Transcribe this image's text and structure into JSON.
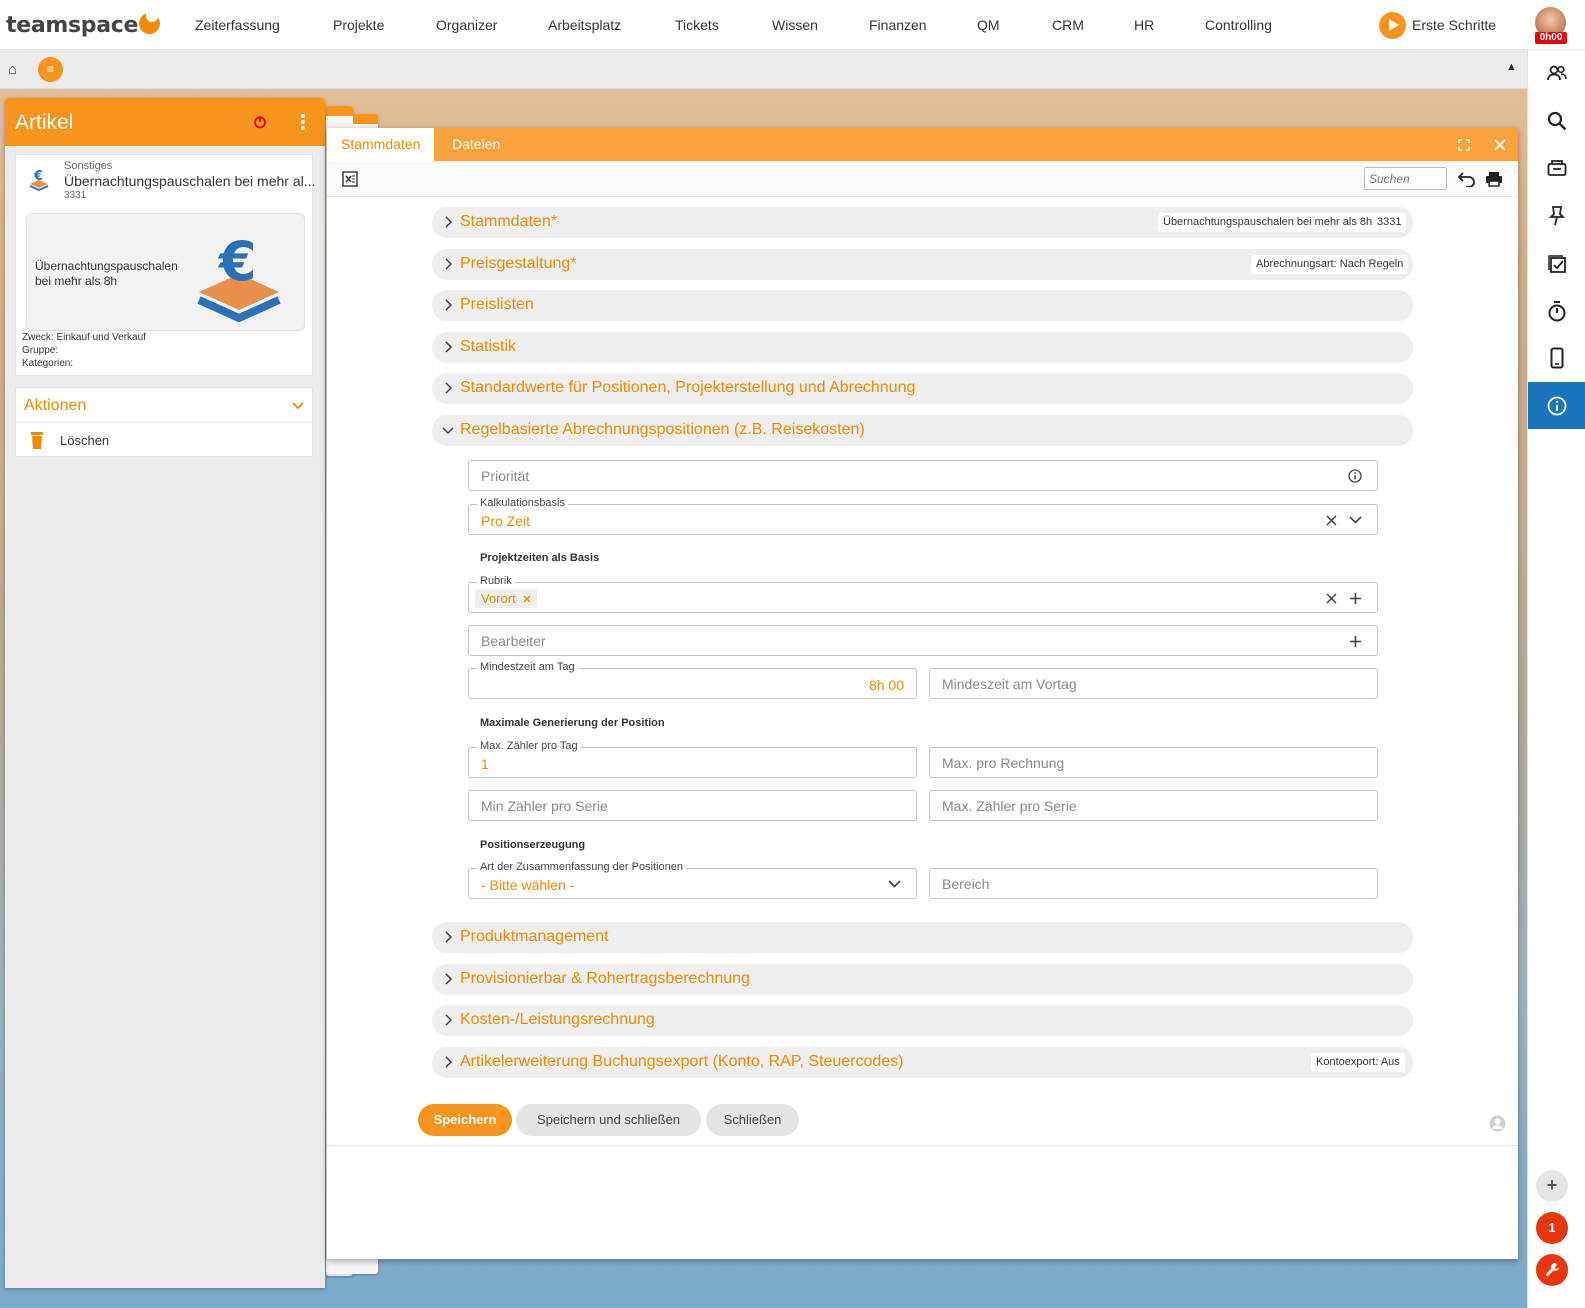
{
  "app": {
    "brand": "teamspace",
    "accent": "#f7941d",
    "accent_text": "#f08a00",
    "info_blue": "#1b75bc"
  },
  "topnav": {
    "items": [
      "Zeiterfassung",
      "Projekte",
      "Organizer",
      "Arbeitsplatz",
      "Tickets",
      "Wissen",
      "Finanzen",
      "QM",
      "CRM",
      "HR",
      "Controlling"
    ],
    "erste_schritte": "Erste Schritte",
    "timer": "0h00"
  },
  "subbar": {
    "home_icon": "house-icon",
    "menu_icon": "menu-icon",
    "collapse_icon": "triangle-up-icon"
  },
  "sidebar_right": {
    "icons": [
      "users-icon",
      "search-icon",
      "inbox-icon",
      "pin-icon",
      "checklist-icon",
      "stopwatch-icon",
      "phone-icon",
      "info-icon"
    ],
    "notification_count": "1"
  },
  "left_panel": {
    "title": "Artikel",
    "card": {
      "category": "Sonstiges",
      "name": "Übernachtungspauschalen bei mehr al...",
      "number": "3331",
      "preview_text_1": "Übernachtungspauschalen",
      "preview_text_2": "bei mehr als 8h",
      "zweck": "Zweck: Einkauf und Verkauf",
      "gruppe": "Gruppe:",
      "kategorien": "Kategorien:"
    },
    "actions": {
      "title": "Aktionen",
      "items": [
        {
          "label": "Löschen",
          "icon": "trash-icon"
        }
      ]
    }
  },
  "dialog": {
    "tabs": [
      {
        "label": "Stammdaten",
        "active": true
      },
      {
        "label": "Dateien",
        "active": false
      }
    ],
    "search_placeholder": "Suchen",
    "sections_top": [
      {
        "title": "Stammdaten*",
        "pills": [
          "Übernachtungspauschalen bei mehr als 8h",
          "3331"
        ]
      },
      {
        "title": "Preisgestaltung*",
        "pills": [
          "Abrechnungsart: Nach Regeln"
        ]
      },
      {
        "title": "Preislisten",
        "pills": []
      },
      {
        "title": "Statistik",
        "pills": []
      },
      {
        "title": "Standardwerte für Positionen, Projekterstellung und Abrechnung",
        "pills": []
      },
      {
        "title": "Regelbasierte Abrechnungspositionen (z.B. Reisekosten)",
        "pills": [],
        "expanded": true
      }
    ],
    "form": {
      "prioritaet_placeholder": "Priorität",
      "kalkulationsbasis_label": "Kalkulationsbasis",
      "kalkulationsbasis_value": "Pro Zeit",
      "projektzeiten_heading": "Projektzeiten als Basis",
      "rubrik_label": "Rubrik",
      "rubrik_chip": "Vorort",
      "bearbeiter_placeholder": "Bearbeiter",
      "mindestzeit_label": "Mindestzeit am Tag",
      "mindestzeit_value": "8h 00",
      "mindestzeit_vortag_placeholder": "Mindeszeit am Vortag",
      "max_gen_heading": "Maximale Generierung der Position",
      "max_zaehler_tag_label": "Max. Zähler pro Tag",
      "max_zaehler_tag_value": "1",
      "max_pro_rechnung_placeholder": "Max. pro Rechnung",
      "min_zaehler_serie_placeholder": "Min Zähler pro Serie",
      "max_zaehler_serie_placeholder": "Max. Zähler pro Serie",
      "positionserzeugung_heading": "Positionserzeugung",
      "art_label": "Art der Zusammenfassung der Positionen",
      "art_value": "- Bitte wählen -",
      "bereich_placeholder": "Bereich"
    },
    "sections_bottom": [
      {
        "title": "Produktmanagement",
        "pills": []
      },
      {
        "title": "Provisionierbar & Rohertragsberechnung",
        "pills": []
      },
      {
        "title": "Kosten-/Leistungsrechnung",
        "pills": []
      },
      {
        "title": "Artikelerweiterung Buchungsexport (Konto, RAP, Steuercodes)",
        "pills": [
          "Kontoexport: Aus"
        ]
      }
    ],
    "buttons": {
      "save": "Speichern",
      "save_close": "Speichern und schließen",
      "close": "Schließen"
    }
  }
}
